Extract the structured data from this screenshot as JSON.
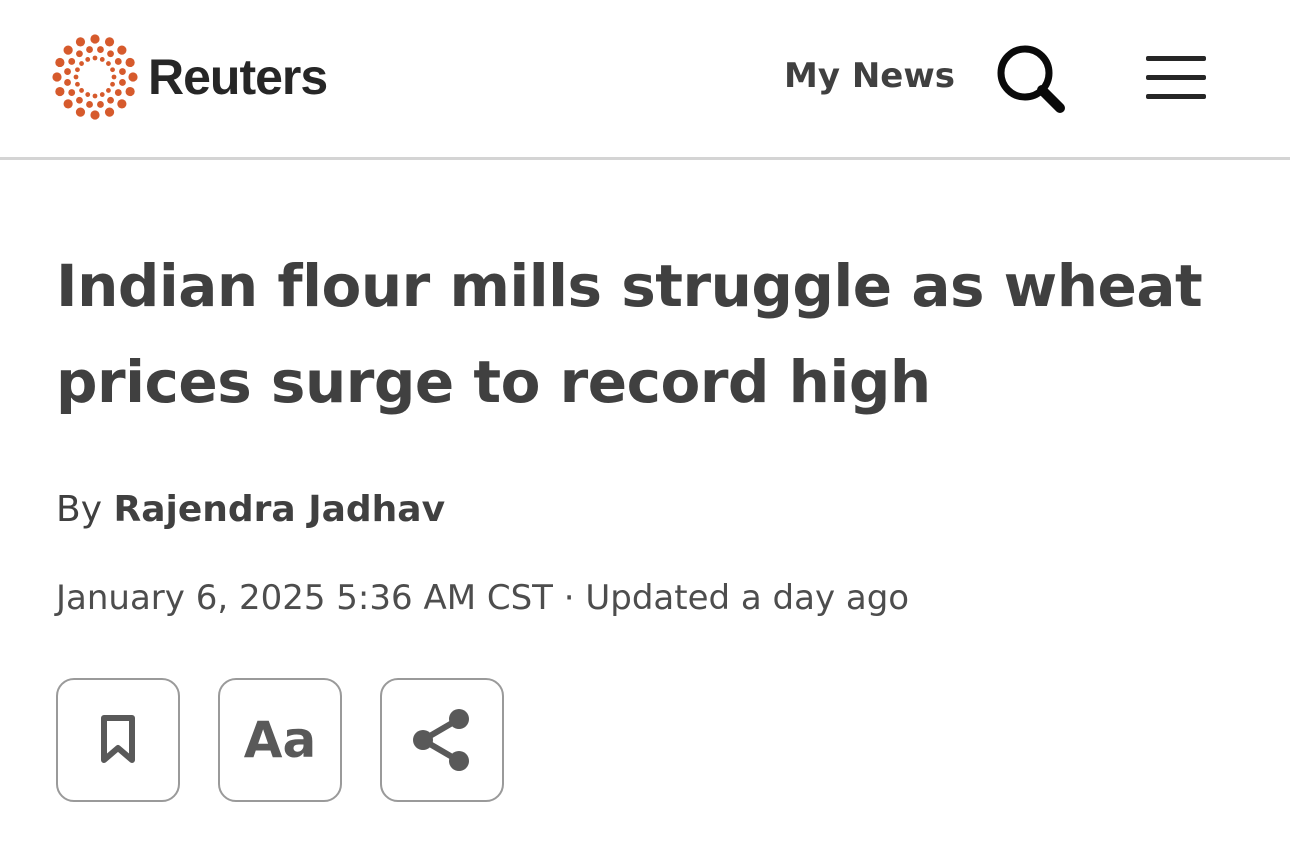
{
  "header": {
    "brand": "Reuters",
    "logo_color": "#d65a2c",
    "my_news_label": "My News",
    "search_icon": "search-icon",
    "menu_icon": "hamburger-menu-icon"
  },
  "article": {
    "headline": "Indian flour mills struggle as wheat prices surge to record high",
    "byline_prefix": "By",
    "author": "Rajendra Jadhav",
    "date": "January 6, 2025 5:36 AM CST",
    "separator": " · ",
    "updated": "Updated a day ago"
  },
  "actions": {
    "bookmark_icon": "bookmark-icon",
    "text_size_label": "Aa",
    "share_icon": "share-icon"
  },
  "colors": {
    "text": "#404040",
    "divider": "#d4d4d4",
    "button_border": "#9a9a9a"
  }
}
